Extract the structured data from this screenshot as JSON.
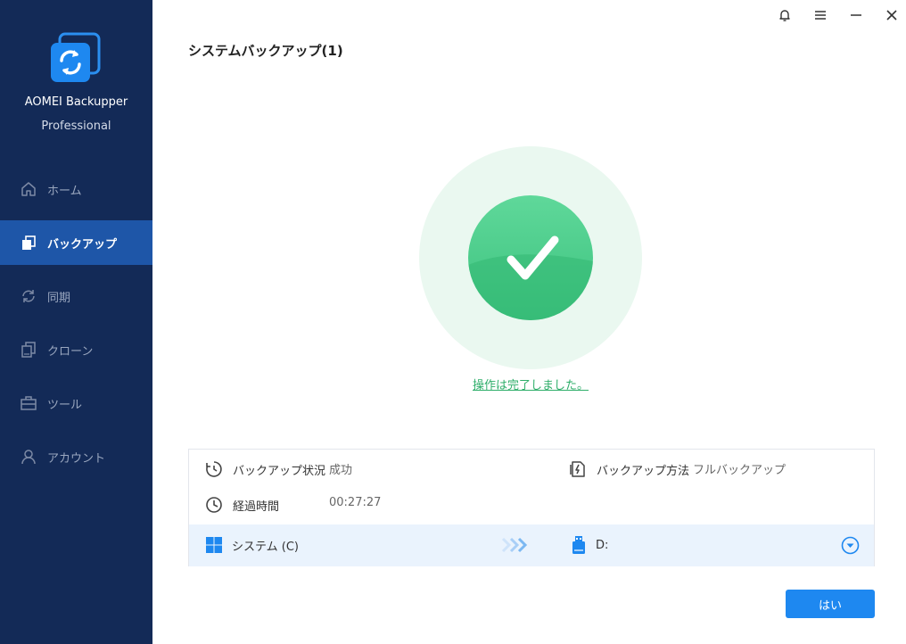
{
  "app": {
    "name": "AOMEI Backupper",
    "edition": "Professional"
  },
  "sidebar": {
    "items": [
      {
        "label": "ホーム",
        "icon": "home-icon",
        "active": false
      },
      {
        "label": "バックアップ",
        "icon": "backup-icon",
        "active": true
      },
      {
        "label": "同期",
        "icon": "sync-icon",
        "active": false
      },
      {
        "label": "クローン",
        "icon": "clone-icon",
        "active": false
      },
      {
        "label": "ツール",
        "icon": "toolbox-icon",
        "active": false
      },
      {
        "label": "アカウント",
        "icon": "user-icon",
        "active": false
      }
    ]
  },
  "titlebar": {
    "icons": [
      "bell-icon",
      "menu-icon",
      "minimize-icon",
      "close-icon"
    ]
  },
  "page": {
    "title": "システムバックアップ(1)"
  },
  "result": {
    "message": "操作は完了しました。",
    "status_color": "#3cc27e"
  },
  "details": {
    "status_label": "バックアップ状況",
    "status_value": "成功",
    "method_label": "バックアップ方法",
    "method_value": "フルバックアップ",
    "elapsed_label": "経過時間",
    "elapsed_value": "00:27:27"
  },
  "route": {
    "source": "システム (C)",
    "destination": "D:"
  },
  "footer": {
    "confirm_label": "はい"
  },
  "colors": {
    "sidebar_bg": "#132a57",
    "active_item": "#1e56a8",
    "accent": "#1e88f0",
    "success": "#3cc27e"
  }
}
